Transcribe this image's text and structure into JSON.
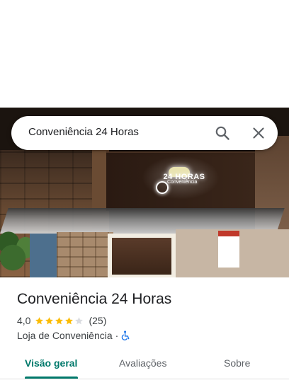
{
  "search": {
    "query": "Conveniência 24 Horas",
    "search_icon": "search-icon",
    "close_icon": "close-icon"
  },
  "photo": {
    "sign_text": "24 HORAS",
    "sign_small": "Conveniência"
  },
  "place": {
    "name": "Conveniência 24 Horas",
    "rating": "4,0",
    "stars_filled": 4,
    "stars_total": 5,
    "review_count": "(25)",
    "category": "Loja de Conveniência",
    "separator": "·",
    "accessibility_icon": "wheelchair-icon"
  },
  "tabs": [
    {
      "label": "Visão geral",
      "active": true
    },
    {
      "label": "Avaliações",
      "active": false
    },
    {
      "label": "Sobre",
      "active": false
    }
  ],
  "colors": {
    "accent": "#00796b",
    "star": "#fbbc04",
    "star_empty": "#dadce0",
    "accessibility": "#1a73e8"
  }
}
